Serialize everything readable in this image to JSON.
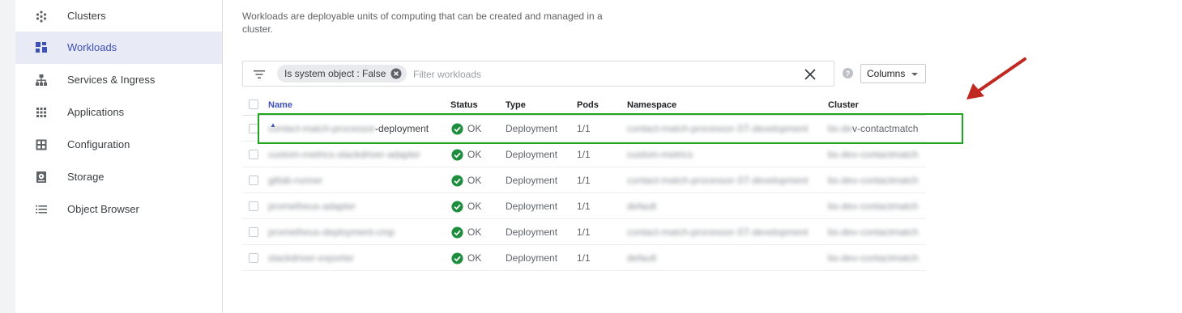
{
  "sidebar": {
    "items": [
      {
        "label": "Clusters",
        "icon": "clusters-icon",
        "active": false
      },
      {
        "label": "Workloads",
        "icon": "workloads-icon",
        "active": true
      },
      {
        "label": "Services & Ingress",
        "icon": "services-icon",
        "active": false
      },
      {
        "label": "Applications",
        "icon": "applications-icon",
        "active": false
      },
      {
        "label": "Configuration",
        "icon": "configuration-icon",
        "active": false
      },
      {
        "label": "Storage",
        "icon": "storage-icon",
        "active": false
      },
      {
        "label": "Object Browser",
        "icon": "object-browser-icon",
        "active": false
      }
    ]
  },
  "description": "Workloads are deployable units of computing that can be created and managed in a cluster.",
  "filter": {
    "chip_key": "Is system object",
    "chip_sep": " : ",
    "chip_value": "False",
    "placeholder": "Filter workloads"
  },
  "columns_button": "Columns",
  "table": {
    "headers": [
      "Name",
      "Status",
      "Type",
      "Pods",
      "Namespace",
      "Cluster"
    ],
    "sort_indicator": "▲",
    "rows": [
      {
        "name_hidden": "contact-match-processor",
        "name_visible": "-deployment",
        "status": "OK",
        "type": "Deployment",
        "pods": "1/1",
        "namespace": "contact-match-processor-ST-development",
        "cluster_hidden": "bs-de",
        "cluster_visible": "v-contactmatch"
      },
      {
        "name_hidden": "custom-metrics-stackdriver-adapter",
        "name_visible": "",
        "status": "OK",
        "type": "Deployment",
        "pods": "1/1",
        "namespace": "custom-metrics",
        "cluster_hidden": "bs-dev-contactmatch",
        "cluster_visible": ""
      },
      {
        "name_hidden": "gitlab-runner",
        "name_visible": "",
        "status": "OK",
        "type": "Deployment",
        "pods": "1/1",
        "namespace": "contact-match-processor-ST-development",
        "cluster_hidden": "bs-dev-contactmatch",
        "cluster_visible": ""
      },
      {
        "name_hidden": "prometheus-adapter",
        "name_visible": "",
        "status": "OK",
        "type": "Deployment",
        "pods": "1/1",
        "namespace": "default",
        "cluster_hidden": "bs-dev-contactmatch",
        "cluster_visible": ""
      },
      {
        "name_hidden": "prometheus-deployment-cmp",
        "name_visible": "",
        "status": "OK",
        "type": "Deployment",
        "pods": "1/1",
        "namespace": "contact-match-processor-ST-development",
        "cluster_hidden": "bs-dev-contactmatch",
        "cluster_visible": ""
      },
      {
        "name_hidden": "stackdriver-exporter",
        "name_visible": "",
        "status": "OK",
        "type": "Deployment",
        "pods": "1/1",
        "namespace": "default",
        "cluster_hidden": "bs-dev-contactmatch",
        "cluster_visible": ""
      }
    ]
  },
  "colors": {
    "accent": "#3f51b5",
    "ok": "#1e8e3e",
    "highlight": "#1ea61e",
    "arrow": "#c0291f"
  }
}
